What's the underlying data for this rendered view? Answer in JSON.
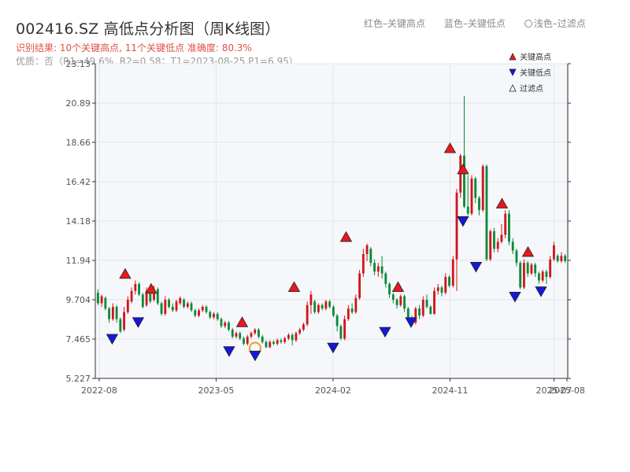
{
  "header": {
    "title": "002416.SZ 高低点分析图（周K线图）",
    "legend_red": "红色–关键高点",
    "legend_blue": "蓝色–关键低点",
    "legend_light": "浅色–过滤点",
    "result_line": "识别结果: 10个关键高点, 11个关键低点  准确度: 80.3%",
    "quality_line": "优质：否（R1=49.6%, R2=0.58；T1=2023-08-25 P1=6.95）"
  },
  "colors": {
    "up": "#d0161b",
    "down": "#0a8a3a",
    "high_marker": "#e8181e",
    "low_marker": "#1518d8",
    "filtered_ring": "#f0a020",
    "plot_bg": "#f5f7fa"
  },
  "chart_data": {
    "type": "candlestick",
    "title": "002416.SZ 高低点分析图（周K线图）",
    "xlabel": "",
    "ylabel": "",
    "y_ticks": [
      "5.227",
      "7.465",
      "9.704",
      "11.94",
      "14.18",
      "16.42",
      "18.66",
      "20.89",
      "23.13"
    ],
    "ylim": [
      5.227,
      23.13
    ],
    "x_ticks": [
      "2022-08",
      "2023-05",
      "2024-02",
      "2024-11",
      "2025-07",
      "2025-08"
    ],
    "legend": {
      "position": "top-right",
      "entries": [
        {
          "label": "关键高点",
          "marker": "triangle-up",
          "color": "#e8181e"
        },
        {
          "label": "关键低点",
          "marker": "triangle-down",
          "color": "#1518d8"
        },
        {
          "label": "过滤点",
          "marker": "triangle-up-hollow",
          "color": "#333333"
        }
      ]
    },
    "key_highs": [
      {
        "date": "2022-10",
        "price": 10.75
      },
      {
        "date": "2022-12",
        "price": 9.9
      },
      {
        "date": "2023-07",
        "price": 8.0
      },
      {
        "date": "2023-11",
        "price": 10.0
      },
      {
        "date": "2024-03",
        "price": 12.85
      },
      {
        "date": "2024-07",
        "price": 10.0
      },
      {
        "date": "2024-11",
        "price": 17.9
      },
      {
        "date": "2024-12",
        "price": 16.7
      },
      {
        "date": "2025-03",
        "price": 14.75
      },
      {
        "date": "2025-05",
        "price": 12.0
      }
    ],
    "key_lows": [
      {
        "date": "2022-09",
        "price": 7.9
      },
      {
        "date": "2022-11",
        "price": 8.85
      },
      {
        "date": "2023-06",
        "price": 7.2
      },
      {
        "date": "2023-08",
        "price": 6.95
      },
      {
        "date": "2024-02",
        "price": 7.4
      },
      {
        "date": "2024-06",
        "price": 8.3
      },
      {
        "date": "2024-08",
        "price": 8.85
      },
      {
        "date": "2024-12",
        "price": 14.6
      },
      {
        "date": "2025-01",
        "price": 12.0
      },
      {
        "date": "2025-04",
        "price": 10.3
      },
      {
        "date": "2025-06",
        "price": 10.6
      }
    ],
    "filtered_points": [
      {
        "date": "2023-08",
        "price": 6.95
      }
    ],
    "candles": [
      [
        10.1,
        9.5,
        10.3,
        9.4
      ],
      [
        9.5,
        9.9,
        10.0,
        9.3
      ],
      [
        9.8,
        9.2,
        9.9,
        9.1
      ],
      [
        9.2,
        8.6,
        9.3,
        8.4
      ],
      [
        8.6,
        9.3,
        9.5,
        8.5
      ],
      [
        9.3,
        8.6,
        9.4,
        8.4
      ],
      [
        8.6,
        7.9,
        8.7,
        7.8
      ],
      [
        8.0,
        9.0,
        9.3,
        7.9
      ],
      [
        9.0,
        9.7,
        9.9,
        8.9
      ],
      [
        9.6,
        10.2,
        10.4,
        9.5
      ],
      [
        10.2,
        10.6,
        10.8,
        10.0
      ],
      [
        10.6,
        10.0,
        10.7,
        9.9
      ],
      [
        10.0,
        9.3,
        10.1,
        9.2
      ],
      [
        9.4,
        10.2,
        10.4,
        9.3
      ],
      [
        10.2,
        9.6,
        10.3,
        9.5
      ],
      [
        9.7,
        10.3,
        10.5,
        9.6
      ],
      [
        10.3,
        9.5,
        10.4,
        9.4
      ],
      [
        9.5,
        8.9,
        9.6,
        8.8
      ],
      [
        8.9,
        9.7,
        9.9,
        8.8
      ],
      [
        9.7,
        9.3,
        9.8,
        9.2
      ],
      [
        9.3,
        9.1,
        9.5,
        9.0
      ],
      [
        9.1,
        9.6,
        9.7,
        9.0
      ],
      [
        9.5,
        9.8,
        9.9,
        9.4
      ],
      [
        9.7,
        9.3,
        9.8,
        9.2
      ],
      [
        9.3,
        9.5,
        9.6,
        9.2
      ],
      [
        9.5,
        9.1,
        9.6,
        9.0
      ],
      [
        9.1,
        8.8,
        9.2,
        8.7
      ],
      [
        8.8,
        9.1,
        9.2,
        8.7
      ],
      [
        9.1,
        9.3,
        9.4,
        9.0
      ],
      [
        9.3,
        9.0,
        9.4,
        8.9
      ],
      [
        9.0,
        8.7,
        9.1,
        8.6
      ],
      [
        8.7,
        8.9,
        9.0,
        8.6
      ],
      [
        8.9,
        8.6,
        9.0,
        8.5
      ],
      [
        8.6,
        8.2,
        8.7,
        8.1
      ],
      [
        8.2,
        8.4,
        8.5,
        8.1
      ],
      [
        8.4,
        8.0,
        8.5,
        7.9
      ],
      [
        8.0,
        7.6,
        8.1,
        7.5
      ],
      [
        7.6,
        7.8,
        7.9,
        7.5
      ],
      [
        7.8,
        7.5,
        7.9,
        7.4
      ],
      [
        7.5,
        7.2,
        7.6,
        7.1
      ],
      [
        7.2,
        7.6,
        7.7,
        7.1
      ],
      [
        7.6,
        7.8,
        7.9,
        7.5
      ],
      [
        7.8,
        8.0,
        8.1,
        7.7
      ],
      [
        8.0,
        7.6,
        8.1,
        7.5
      ],
      [
        7.6,
        7.3,
        7.7,
        7.2
      ],
      [
        7.3,
        7.0,
        7.4,
        6.95
      ],
      [
        7.0,
        7.3,
        7.4,
        6.95
      ],
      [
        7.3,
        7.2,
        7.4,
        7.1
      ],
      [
        7.2,
        7.4,
        7.5,
        7.1
      ],
      [
        7.4,
        7.3,
        7.5,
        7.2
      ],
      [
        7.3,
        7.5,
        7.6,
        7.2
      ],
      [
        7.5,
        7.7,
        7.8,
        7.4
      ],
      [
        7.7,
        7.4,
        7.8,
        7.1
      ],
      [
        7.4,
        7.8,
        7.9,
        7.3
      ],
      [
        7.8,
        8.0,
        8.1,
        7.7
      ],
      [
        8.0,
        8.3,
        8.4,
        7.9
      ],
      [
        8.3,
        9.4,
        9.6,
        8.2
      ],
      [
        9.4,
        10.0,
        10.2,
        8.9
      ],
      [
        9.6,
        9.0,
        9.7,
        8.9
      ],
      [
        9.0,
        9.4,
        9.5,
        8.9
      ],
      [
        9.4,
        9.2,
        9.5,
        9.1
      ],
      [
        9.2,
        9.6,
        9.7,
        9.1
      ],
      [
        9.6,
        9.3,
        9.7,
        9.2
      ],
      [
        9.3,
        8.8,
        9.4,
        8.7
      ],
      [
        8.8,
        8.2,
        8.9,
        7.9
      ],
      [
        8.2,
        7.5,
        8.3,
        7.4
      ],
      [
        7.5,
        8.6,
        8.8,
        7.4
      ],
      [
        8.6,
        9.2,
        9.4,
        8.5
      ],
      [
        9.2,
        9.0,
        9.5,
        8.9
      ],
      [
        9.0,
        9.8,
        10.0,
        8.9
      ],
      [
        9.8,
        11.2,
        11.4,
        9.7
      ],
      [
        11.2,
        12.3,
        12.6,
        11.0
      ],
      [
        12.3,
        12.8,
        12.9,
        11.9
      ],
      [
        12.6,
        11.8,
        12.7,
        11.6
      ],
      [
        11.8,
        11.3,
        12.0,
        11.1
      ],
      [
        11.3,
        11.6,
        11.8,
        11.0
      ],
      [
        11.6,
        11.2,
        12.2,
        10.9
      ],
      [
        11.2,
        10.6,
        11.3,
        10.4
      ],
      [
        10.6,
        10.0,
        10.7,
        9.8
      ],
      [
        10.0,
        9.7,
        10.1,
        9.5
      ],
      [
        9.7,
        9.4,
        9.8,
        9.2
      ],
      [
        9.4,
        9.9,
        10.0,
        9.3
      ],
      [
        9.9,
        9.2,
        10.0,
        9.0
      ],
      [
        9.2,
        8.7,
        9.3,
        8.5
      ],
      [
        8.7,
        8.4,
        8.8,
        8.3
      ],
      [
        8.4,
        9.2,
        9.3,
        8.3
      ],
      [
        9.2,
        8.8,
        9.4,
        8.6
      ],
      [
        8.8,
        9.7,
        9.9,
        8.7
      ],
      [
        9.7,
        9.3,
        10.0,
        9.2
      ],
      [
        9.3,
        8.9,
        9.4,
        8.85
      ],
      [
        8.9,
        10.2,
        10.4,
        8.85
      ],
      [
        10.2,
        10.4,
        10.6,
        10.0
      ],
      [
        10.4,
        10.1,
        10.5,
        9.9
      ],
      [
        10.1,
        11.0,
        11.2,
        10.0
      ],
      [
        11.0,
        10.5,
        11.1,
        10.4
      ],
      [
        10.5,
        12.0,
        12.2,
        10.4
      ],
      [
        12.0,
        15.8,
        16.0,
        10.2
      ],
      [
        15.8,
        17.9,
        18.0,
        15.5
      ],
      [
        17.9,
        15.0,
        21.3,
        14.9
      ],
      [
        15.0,
        14.6,
        16.8,
        14.5
      ],
      [
        14.6,
        16.6,
        16.8,
        14.5
      ],
      [
        16.6,
        15.5,
        16.7,
        15.2
      ],
      [
        15.5,
        14.8,
        15.6,
        14.5
      ],
      [
        14.8,
        17.3,
        17.4,
        14.7
      ],
      [
        17.3,
        12.0,
        17.4,
        11.9
      ],
      [
        12.0,
        13.6,
        13.7,
        11.9
      ],
      [
        13.6,
        12.6,
        13.8,
        12.4
      ],
      [
        12.6,
        13.0,
        13.2,
        12.4
      ],
      [
        13.0,
        13.4,
        14.0,
        12.9
      ],
      [
        13.4,
        14.6,
        14.8,
        13.2
      ],
      [
        14.6,
        13.0,
        14.8,
        12.8
      ],
      [
        13.0,
        12.5,
        13.2,
        12.3
      ],
      [
        12.5,
        11.8,
        12.6,
        11.6
      ],
      [
        11.8,
        10.4,
        11.9,
        10.3
      ],
      [
        10.4,
        11.8,
        12.0,
        10.3
      ],
      [
        11.8,
        11.2,
        11.9,
        11.0
      ],
      [
        11.2,
        11.7,
        11.8,
        11.1
      ],
      [
        11.7,
        11.2,
        11.8,
        11.0
      ],
      [
        11.2,
        10.8,
        11.3,
        10.6
      ],
      [
        10.8,
        11.3,
        11.4,
        10.7
      ],
      [
        11.3,
        11.0,
        11.4,
        10.6
      ],
      [
        11.0,
        12.0,
        12.2,
        10.9
      ],
      [
        12.0,
        12.8,
        13.0,
        11.9
      ],
      [
        12.2,
        11.9,
        12.3,
        11.8
      ],
      [
        11.9,
        12.2,
        12.4,
        11.8
      ],
      [
        12.2,
        11.9,
        12.3,
        11.8
      ]
    ]
  }
}
